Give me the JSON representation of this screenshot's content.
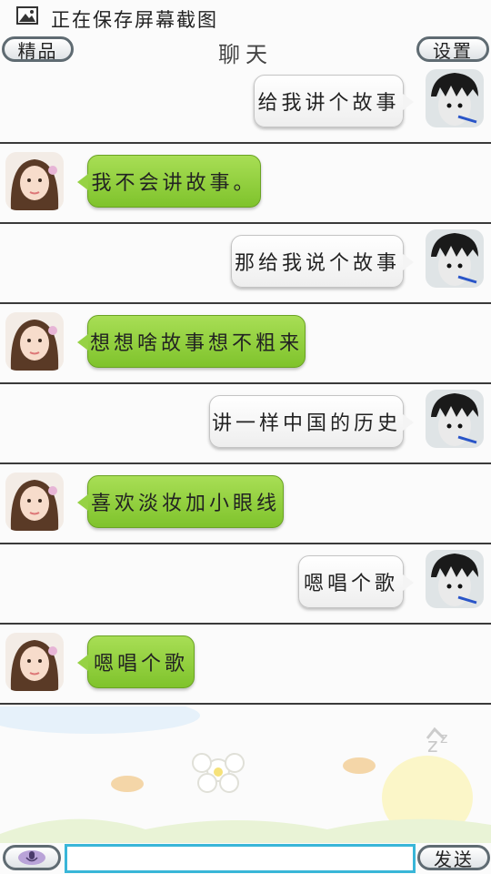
{
  "status_bar": {
    "icon": "image-icon",
    "text": "正在保存屏幕截图"
  },
  "header": {
    "left_button": "精品",
    "title": "聊天",
    "right_button": "设置"
  },
  "messages": [
    {
      "from": "me",
      "text": "给我讲个故事"
    },
    {
      "from": "bot",
      "text": "我不会讲故事。"
    },
    {
      "from": "me",
      "text": "那给我说个故事"
    },
    {
      "from": "bot",
      "text": "想想啥故事想不粗来"
    },
    {
      "from": "me",
      "text": "讲一样中国的历史"
    },
    {
      "from": "bot",
      "text": "喜欢淡妆加小眼线"
    },
    {
      "from": "me",
      "text": "嗯唱个歌"
    },
    {
      "from": "bot",
      "text": "嗯唱个歌"
    }
  ],
  "bottom_bar": {
    "mic_icon": "microphone-icon",
    "input_value": "",
    "send_button": "发送"
  },
  "colors": {
    "bot_bubble": "#8fcf3c",
    "me_bubble": "#f4f4f4",
    "input_border": "#39b6d8"
  }
}
